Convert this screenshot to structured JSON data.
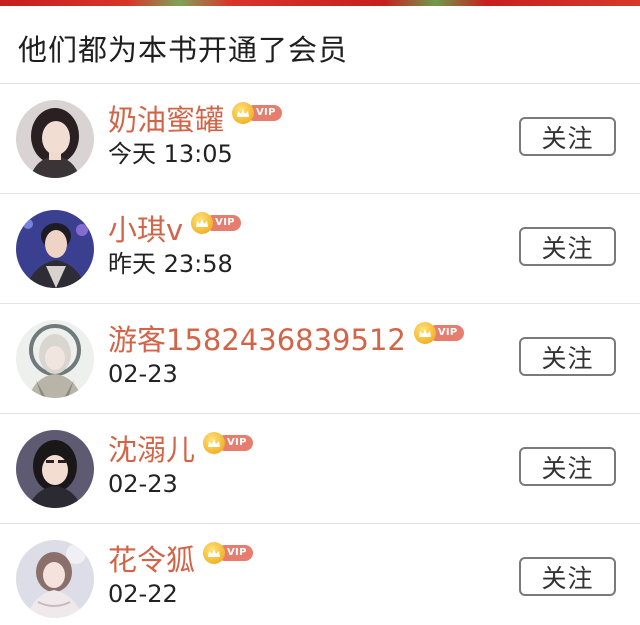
{
  "header": {
    "title": "他们都为本书开通了会员"
  },
  "vip_badge_text": "VIP",
  "members": [
    {
      "name": "奶油蜜罐",
      "time": "今天 13:05",
      "follow_label": "关注",
      "avatar_icon": "avatar-photo"
    },
    {
      "name": "小琪v",
      "time": "昨天 23:58",
      "follow_label": "关注",
      "avatar_icon": "avatar-photo"
    },
    {
      "name": "游客1582436839512",
      "time": "02-23",
      "follow_label": "关注",
      "avatar_icon": "avatar-illustration"
    },
    {
      "name": "沈溺儿",
      "time": "02-23",
      "follow_label": "关注",
      "avatar_icon": "avatar-photo"
    },
    {
      "name": "花令狐",
      "time": "02-22",
      "follow_label": "关注",
      "avatar_icon": "avatar-photo"
    }
  ],
  "colors": {
    "name": "#d26548",
    "vip_pill": "#e77d6e",
    "crown": "#f2b52a",
    "divider": "#e3e3e3",
    "banner": "#c81e1e"
  }
}
